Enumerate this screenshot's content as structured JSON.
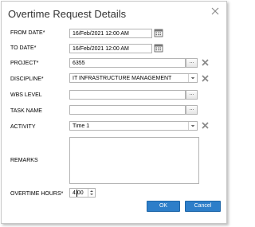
{
  "dialog": {
    "title": "Overtime Request Details",
    "close_icon": "close-icon"
  },
  "form": {
    "from_date": {
      "label": "FROM DATE*",
      "value": "16/Feb/2021 12:00 AM",
      "icon": "calendar-icon"
    },
    "to_date": {
      "label": "TO DATE*",
      "value": "16/Feb/2021 12:00 AM",
      "icon": "calendar-icon"
    },
    "project": {
      "label": "PROJECT*",
      "value": "6355",
      "browse_label": "...",
      "clear_icon": "clear-x-icon"
    },
    "discipline": {
      "label": "DISCIPLINE*",
      "value": "IT INFRASTRUCTURE MANAGEMENT",
      "clear_icon": "clear-x-icon"
    },
    "wbs_level": {
      "label": "WBS LEVEL",
      "value": "",
      "browse_label": "..."
    },
    "task_name": {
      "label": "TASK NAME",
      "value": "",
      "browse_label": "..."
    },
    "activity": {
      "label": "ACTIVITY",
      "value": "Time 1",
      "clear_icon": "clear-x-icon"
    },
    "remarks": {
      "label": "REMARKS",
      "value": ""
    },
    "overtime_hours": {
      "label": "OVERTIME HOURS*",
      "value": "4.00"
    }
  },
  "buttons": {
    "ok": "OK",
    "cancel": "Cancel",
    "accent_color": "#2d7ec9"
  }
}
